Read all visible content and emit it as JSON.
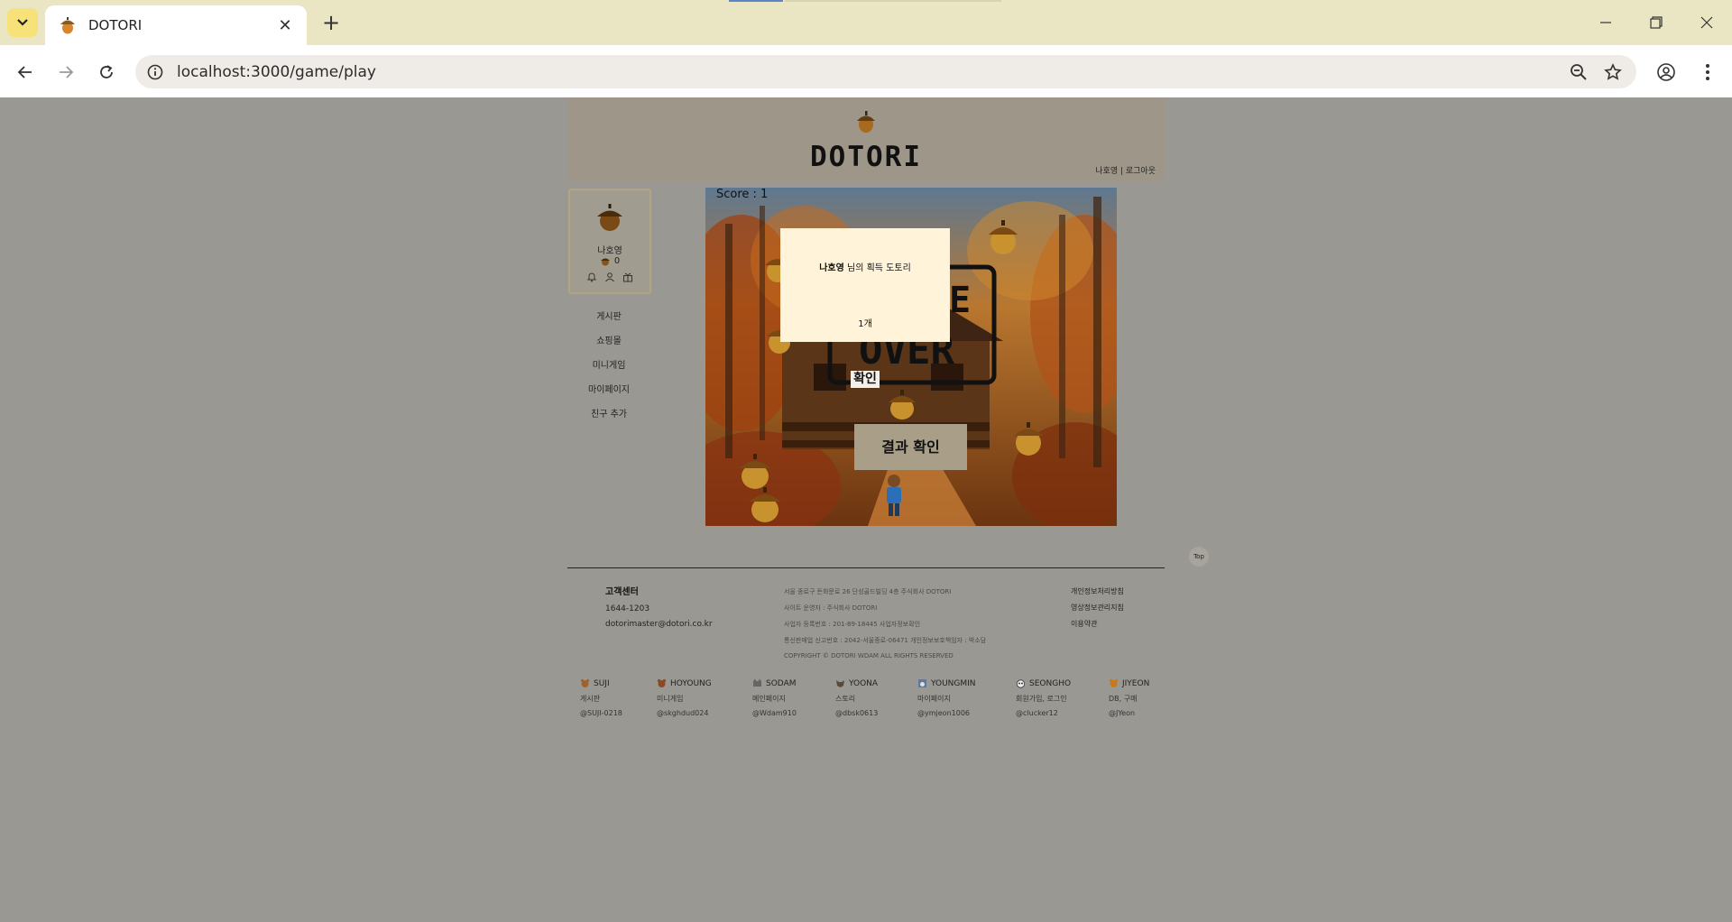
{
  "browser": {
    "tab_title": "DOTORI",
    "url": "localhost:3000/game/play",
    "window_controls": [
      "minimize-icon",
      "restore-icon",
      "close-icon"
    ]
  },
  "header": {
    "logo": "DOTORI",
    "user_links": "나호영 | 로그아웃"
  },
  "profile": {
    "name": "나호영",
    "acorns": "0",
    "icons": [
      "bell-icon",
      "person-icon",
      "gift-icon"
    ]
  },
  "side_nav": {
    "items": [
      {
        "label": "게시판"
      },
      {
        "label": "쇼핑몰"
      },
      {
        "label": "미니게임"
      },
      {
        "label": "마이페이지"
      },
      {
        "label": "친구 추가"
      }
    ]
  },
  "game": {
    "score_label": "Score : 1",
    "modal": {
      "user": "나호영",
      "message_suffix": " 님의 획득 도토리",
      "count": "1개"
    },
    "confirm_label": "확인",
    "result_button": "결과 확인"
  },
  "footer": {
    "top_label": "Top",
    "customer_center": {
      "title": "고객센터",
      "phone": "1644-1203",
      "email": "dotorimaster@dotori.co.kr"
    },
    "company_lines": [
      "서울 종로구 돈화문로 26 단성골드빌딩 4층 주식회사 DOTORI",
      "사이트 운영자 : 주식회사 DOTORI",
      "사업자 등록번호 : 201-89-18445 사업자정보확인",
      "통신판매업 신고번호 : 2042-서울종로-06471 개인정보보호책임자 : 박소담",
      "COPYRIGHT © DOTORI WDAM ALL RIGHTS RESERVED"
    ],
    "policies": [
      "개인정보처리방침",
      "영상정보관리지침",
      "이용약관"
    ],
    "members": [
      {
        "name": "SUJI",
        "role": "게시판",
        "id": "@SUJI-0218"
      },
      {
        "name": "HOYOUNG",
        "role": "미니게임",
        "id": "@skghdud024"
      },
      {
        "name": "SODAM",
        "role": "메인페이지",
        "id": "@Wdam910"
      },
      {
        "name": "YOONA",
        "role": "스토리",
        "id": "@dbsk0613"
      },
      {
        "name": "YOUNGMIN",
        "role": "마이페이지",
        "id": "@ymjeon1006"
      },
      {
        "name": "SEONGHO",
        "role": "회원가입, 로그인",
        "id": "@clucker12"
      },
      {
        "name": "JIYEON",
        "role": "DB, 구매",
        "id": "@JYeon"
      }
    ]
  }
}
